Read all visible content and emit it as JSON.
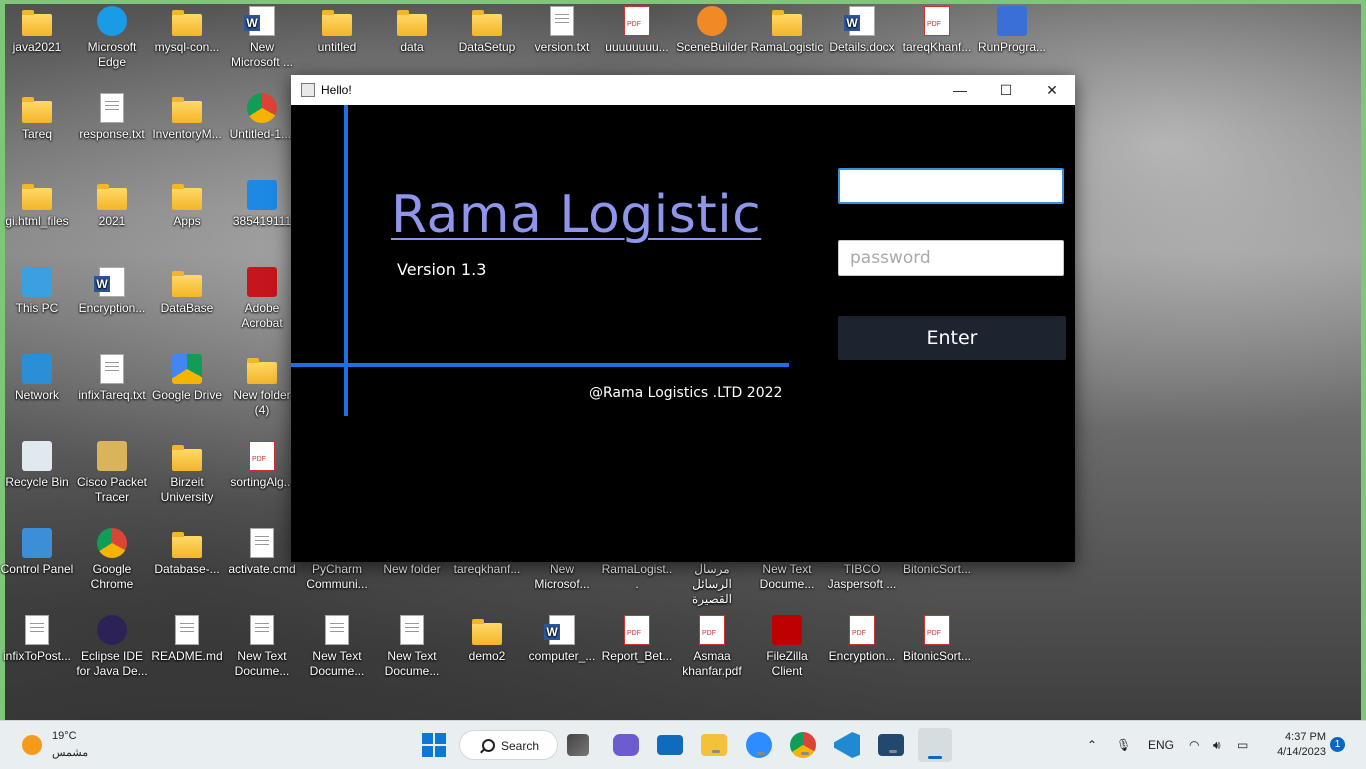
{
  "desktop": {
    "icons": [
      {
        "label": "java2021",
        "glyph": "folder-icon"
      },
      {
        "label": "Microsoft Edge",
        "glyph": "edge-icon"
      },
      {
        "label": "mysql-con...",
        "glyph": "folder-icon"
      },
      {
        "label": "New Microsoft ...",
        "glyph": "word-doc-icon"
      },
      {
        "label": "untitled",
        "glyph": "folder-icon"
      },
      {
        "label": "data",
        "glyph": "folder-icon"
      },
      {
        "label": "DataSetup",
        "glyph": "folder-icon"
      },
      {
        "label": "version.txt",
        "glyph": "text-file-icon"
      },
      {
        "label": "uuuuuuuu...",
        "glyph": "pdf-icon"
      },
      {
        "label": "SceneBuilder",
        "glyph": "scenebuilder-icon"
      },
      {
        "label": "RamaLogistic",
        "glyph": "folder-icon"
      },
      {
        "label": "Details.docx",
        "glyph": "word-doc-icon"
      },
      {
        "label": "tareqKhanf...",
        "glyph": "pdf-icon"
      },
      {
        "label": "RunProgra...",
        "glyph": "run-program-icon"
      },
      {
        "label": "Tareq",
        "glyph": "folder-icon"
      },
      {
        "label": "response.txt",
        "glyph": "text-file-icon"
      },
      {
        "label": "InventoryM...",
        "glyph": "folder-icon"
      },
      {
        "label": "Untitled-1....",
        "glyph": "chrome-icon"
      },
      {
        "label": "gi.html_files",
        "glyph": "folder-icon"
      },
      {
        "label": "2021",
        "glyph": "folder-icon"
      },
      {
        "label": "Apps",
        "glyph": "folder-icon"
      },
      {
        "label": "385419111",
        "glyph": "image-icon"
      },
      {
        "label": "This PC",
        "glyph": "this-pc-icon"
      },
      {
        "label": "Encryption...",
        "glyph": "word-doc-icon"
      },
      {
        "label": "DataBase",
        "glyph": "folder-icon"
      },
      {
        "label": "Adobe Acrobat",
        "glyph": "acrobat-icon"
      },
      {
        "label": "Network",
        "glyph": "network-icon"
      },
      {
        "label": "infixTareq.txt",
        "glyph": "text-file-icon"
      },
      {
        "label": "Google Drive",
        "glyph": "google-drive-icon"
      },
      {
        "label": "New folder (4)",
        "glyph": "folder-icon"
      },
      {
        "label": "Recycle Bin",
        "glyph": "recycle-bin-icon"
      },
      {
        "label": "Cisco Packet Tracer",
        "glyph": "packet-tracer-icon"
      },
      {
        "label": "Birzeit University",
        "glyph": "folder-icon"
      },
      {
        "label": "sortingAlg...",
        "glyph": "pdf-icon"
      },
      {
        "label": "Control Panel",
        "glyph": "control-panel-icon"
      },
      {
        "label": "Google Chrome",
        "glyph": "chrome-icon"
      },
      {
        "label": "Database-...",
        "glyph": "folder-icon"
      },
      {
        "label": "activate.cmd",
        "glyph": "cmd-file-icon"
      },
      {
        "label": "PyCharm Communi...",
        "glyph": "pycharm-icon"
      },
      {
        "label": "New folder",
        "glyph": "folder-icon"
      },
      {
        "label": "tareqkhanf...",
        "glyph": "pdf-icon"
      },
      {
        "label": "New Microsof...",
        "glyph": "word-doc-icon"
      },
      {
        "label": "RamaLogist...",
        "glyph": "pdf-icon"
      },
      {
        "label": "مرسال الرسائل القصيرة",
        "glyph": "pdf-icon"
      },
      {
        "label": "New Text Docume...",
        "glyph": "text-file-icon"
      },
      {
        "label": "TIBCO Jaspersoft ...",
        "glyph": "jaspersoft-icon"
      },
      {
        "label": "BitonicSort...",
        "glyph": "pdf-icon"
      },
      {
        "label": "infixToPost...",
        "glyph": "text-file-icon"
      },
      {
        "label": "Eclipse IDE for Java De...",
        "glyph": "eclipse-icon"
      },
      {
        "label": "README.md",
        "glyph": "markdown-file-icon"
      },
      {
        "label": "New Text Docume...",
        "glyph": "text-file-icon"
      },
      {
        "label": "New Text Docume...",
        "glyph": "text-file-icon"
      },
      {
        "label": "New Text Docume...",
        "glyph": "text-file-icon"
      },
      {
        "label": "demo2",
        "glyph": "folder-icon"
      },
      {
        "label": "computer_...",
        "glyph": "word-doc-icon"
      },
      {
        "label": "Report_Bet...",
        "glyph": "pdf-icon"
      },
      {
        "label": "Asmaa khanfar.pdf",
        "glyph": "pdf-icon"
      },
      {
        "label": "FileZilla Client",
        "glyph": "filezilla-icon"
      },
      {
        "label": "Encryption...",
        "glyph": "pdf-icon"
      },
      {
        "label": "BitonicSort...",
        "glyph": "pdf-icon"
      }
    ]
  },
  "window": {
    "title": "Hello!",
    "minimize_glyph": "—",
    "maximize_glyph": "☐",
    "close_glyph": "✕"
  },
  "app": {
    "brand": "Rama Logistic",
    "version": "Version 1.3",
    "copyright": "@Rama Logistics .LTD 2022",
    "username_value": "",
    "password_placeholder": "password",
    "enter_label": "Enter",
    "colors": {
      "accent_line": "#1f6fe0",
      "brand_text": "#8e95ea",
      "button_bg": "#1d2430"
    }
  },
  "taskbar": {
    "weather_temp": "19°C",
    "weather_desc": "مشمس",
    "search_label": "Search",
    "language": "ENG",
    "time": "4:37 PM",
    "date": "4/14/2023",
    "notifications": "1"
  }
}
